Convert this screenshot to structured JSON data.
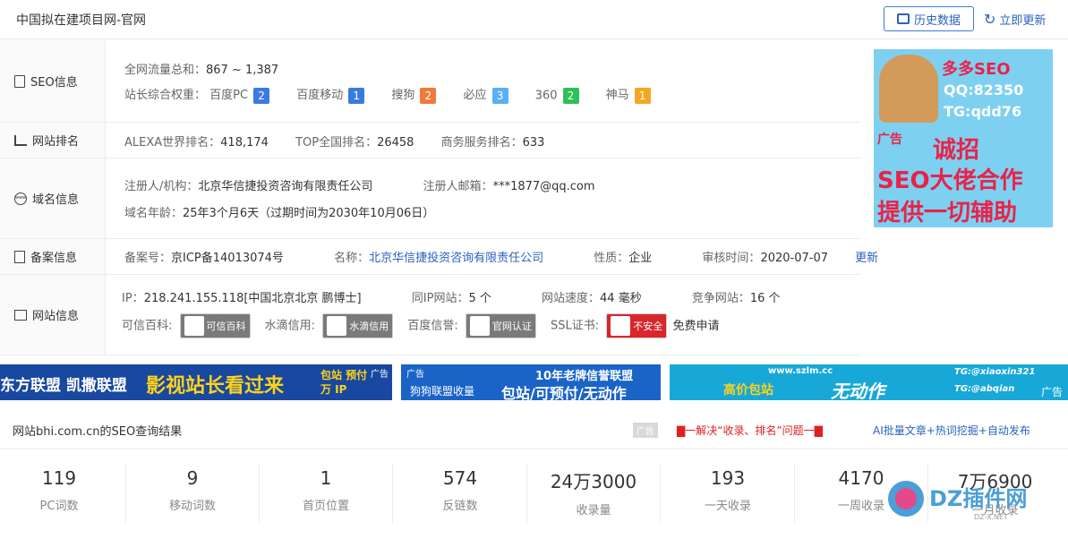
{
  "header": {
    "title": "中国拟在建项目网-官网",
    "history_btn": "历史数据",
    "update_btn": "立即更新"
  },
  "seo": {
    "label": "SEO信息",
    "traffic_label": "全网流量总和：",
    "traffic_value": "867 ~ 1,387",
    "weight_label": "站长综合权重：",
    "weights": [
      {
        "name": "百度PC",
        "value": "2",
        "color": "#3a7be0"
      },
      {
        "name": "百度移动",
        "value": "1",
        "color": "#3a7be0"
      },
      {
        "name": "搜狗",
        "value": "2",
        "color": "#f07a3a"
      },
      {
        "name": "必应",
        "value": "3",
        "color": "#5ab0f0"
      },
      {
        "name": "360",
        "value": "2",
        "color": "#2ec05a"
      },
      {
        "name": "神马",
        "value": "1",
        "color": "#f5a623"
      }
    ]
  },
  "rank": {
    "label": "网站排名",
    "alexa_label": "ALEXA世界排名：",
    "alexa_value": "418,174",
    "top_label": "TOP全国排名：",
    "top_value": "26458",
    "biz_label": "商务服务排名：",
    "biz_value": "633"
  },
  "domain": {
    "label": "域名信息",
    "registrant_label": "注册人/机构：",
    "registrant_value": "北京华信捷投资咨询有限责任公司",
    "email_label": "注册人邮箱：",
    "email_value": "***1877@qq.com",
    "age_label": "域名年龄：",
    "age_value": "25年3个月6天（过期时间为2030年10月06日）"
  },
  "icp": {
    "label": "备案信息",
    "no_label": "备案号：",
    "no_value": "京ICP备14013074号",
    "name_label": "名称：",
    "name_value": "北京华信捷投资咨询有限责任公司",
    "type_label": "性质：",
    "type_value": "企业",
    "date_label": "审核时间：",
    "date_value": "2020-07-07",
    "update_link": "更新"
  },
  "site": {
    "label": "网站信息",
    "ip_label": "IP：",
    "ip_value": "218.241.155.118[中国北京北京 鹏博士]",
    "sameip_label": "同IP网站：",
    "sameip_value": "5 个",
    "speed_label": "网站速度：",
    "speed_value": "44 毫秒",
    "compete_label": "竞争网站：",
    "compete_value": "16 个",
    "kexin_label": "可信百科:",
    "kexin_chip": "可信百科",
    "shuidi_label": "水滴信用:",
    "shuidi_chip": "水滴信用",
    "baidu_label": "百度信誉:",
    "baidu_chip": "官网认证",
    "ssl_label": "SSL证书:",
    "ssl_chip": "不安全",
    "ssl_apply": "免费申请"
  },
  "side_ad": {
    "line1": "多多SEO",
    "line2": "QQ:82350",
    "line3": "TG:qdd76",
    "tag": "广告",
    "line4": "诚招",
    "line5": "SEO大佬合作",
    "line6": "提供一切辅助"
  },
  "banners": {
    "b1_text": "东方联盟 凯撒联盟",
    "b1_main": "影视站长看过来",
    "b1_side": "包站 预付 万 IP",
    "b1_tag": "广告",
    "b2_tag": "广告",
    "b2_left": "狗狗联盟收量",
    "b2_top": "10年老牌信誉联盟",
    "b2_main": "包站/可预付/无动作",
    "b3_site": "www.szlm.cc",
    "b3_left": "高价包站",
    "b3_main": "无动作",
    "b3_tg1": "TG:@xiaoxin321",
    "b3_tg2": "TG:@abqian",
    "b3_tag": "广告"
  },
  "result": {
    "title": "网站bhi.com.cn的SEO查询结果",
    "ad": "广告",
    "link1": "▇一解决“收录、排名”问题一▇",
    "link2": "AI批量文章+热词挖掘+自动发布"
  },
  "stats": [
    {
      "num": "119",
      "cap": "PC词数"
    },
    {
      "num": "9",
      "cap": "移动词数"
    },
    {
      "num": "1",
      "cap": "首页位置"
    },
    {
      "num": "574",
      "cap": "反链数"
    },
    {
      "num": "24万3000",
      "cap": "收录量"
    },
    {
      "num": "193",
      "cap": "一天收录"
    },
    {
      "num": "4170",
      "cap": "一周收录"
    },
    {
      "num": "7万6900",
      "cap": "一月收录"
    }
  ],
  "watermark": {
    "text": "DZ插件网",
    "sub": "DZ-X.NET"
  }
}
